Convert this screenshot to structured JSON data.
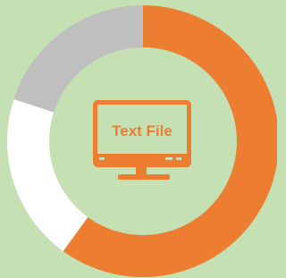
{
  "colors": {
    "background": "#c5e0b3",
    "accent": "#ed7d31"
  },
  "center": {
    "icon": "monitor-icon",
    "label": "Text File"
  },
  "chart_data": {
    "type": "pie",
    "variant": "donut",
    "start": "top",
    "direction": "clockwise",
    "slices": [
      {
        "value": 0.6,
        "color": "#ed7d31"
      },
      {
        "value": 0.2,
        "color": "#ffffff"
      },
      {
        "value": 0.2,
        "color": "#bfbfbf"
      }
    ]
  }
}
